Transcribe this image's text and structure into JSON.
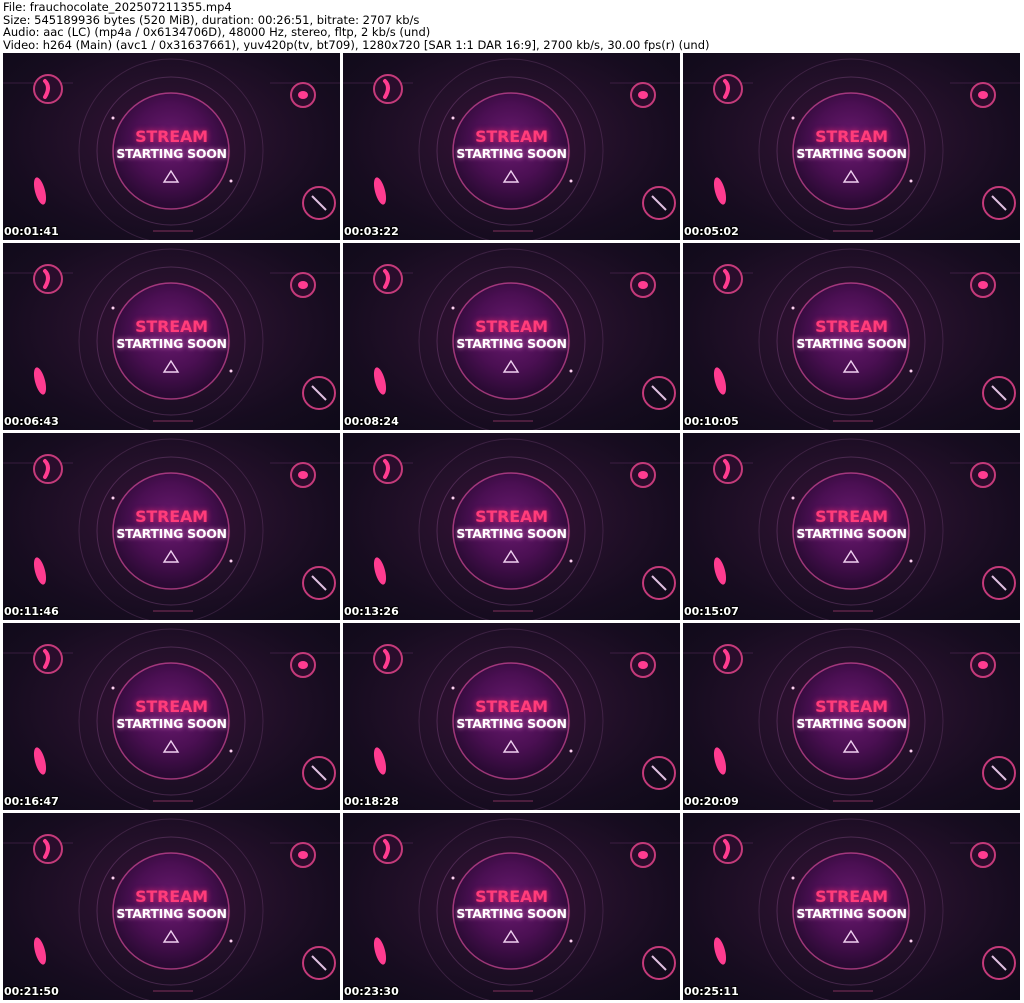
{
  "header": {
    "file": "File: frauchocolate_202507211355.mp4",
    "size": "Size: 545189936 bytes (520 MiB), duration: 00:26:51, bitrate: 2707 kb/s",
    "audio": "Audio: aac (LC) (mp4a / 0x6134706D), 48000 Hz, stereo, fltp, 2 kb/s (und)",
    "video": "Video: h264 (Main) (avc1 / 0x31637661), yuv420p(tv, bt709), 1280x720 [SAR 1:1 DAR 16:9], 2700 kb/s, 30.00 fps(r) (und)"
  },
  "frame_text": {
    "line1": "STREAM",
    "line2": "STARTING SOON"
  },
  "colors": {
    "accent_pink": "#ff3c7a",
    "orb_purple": "#7a1a7a",
    "background_dark": "#160c1f"
  },
  "thumbnails": [
    {
      "timestamp": "00:01:41"
    },
    {
      "timestamp": "00:03:22"
    },
    {
      "timestamp": "00:05:02"
    },
    {
      "timestamp": "00:06:43"
    },
    {
      "timestamp": "00:08:24"
    },
    {
      "timestamp": "00:10:05"
    },
    {
      "timestamp": "00:11:46"
    },
    {
      "timestamp": "00:13:26"
    },
    {
      "timestamp": "00:15:07"
    },
    {
      "timestamp": "00:16:47"
    },
    {
      "timestamp": "00:18:28"
    },
    {
      "timestamp": "00:20:09"
    },
    {
      "timestamp": "00:21:50"
    },
    {
      "timestamp": "00:23:30"
    },
    {
      "timestamp": "00:25:11"
    }
  ]
}
